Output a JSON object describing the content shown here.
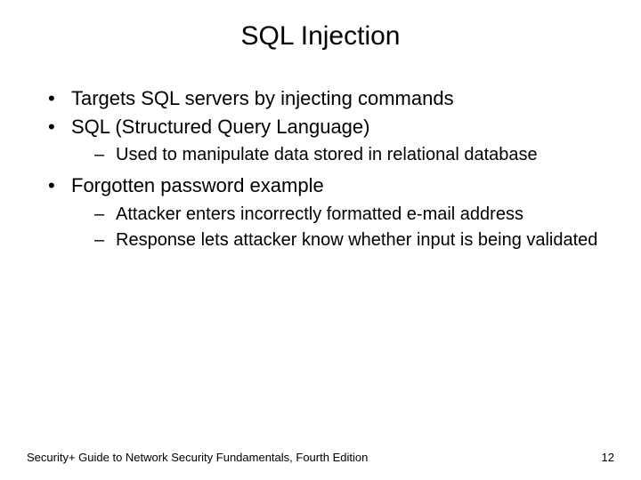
{
  "title": "SQL Injection",
  "bullets": {
    "b0": "Targets SQL servers by injecting commands",
    "b1": "SQL (Structured Query Language)",
    "b1_sub": {
      "s0": "Used to manipulate data stored in relational database"
    },
    "b2": "Forgotten password example",
    "b2_sub": {
      "s0": "Attacker enters incorrectly formatted e-mail address",
      "s1": "Response lets attacker know whether input is being validated"
    }
  },
  "footer": {
    "text": "Security+ Guide to Network Security Fundamentals, Fourth Edition",
    "page": "12"
  }
}
